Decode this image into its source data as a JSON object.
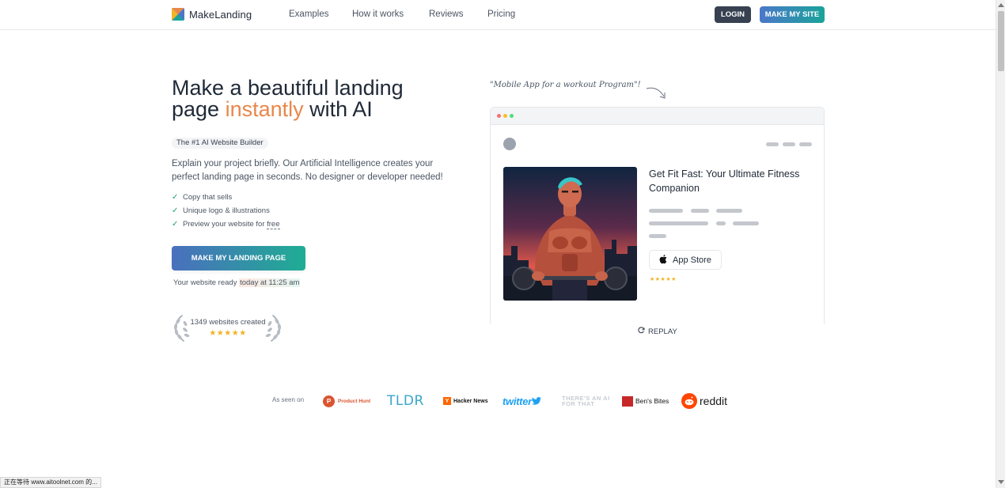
{
  "header": {
    "brand": "MakeLanding",
    "nav": [
      "Examples",
      "How it works",
      "Reviews",
      "Pricing"
    ],
    "login_label": "LOGIN",
    "make_site_label": "MAKE MY SITE"
  },
  "hero": {
    "title_line1": "Make a beautiful landing",
    "title_page": "page",
    "title_accent": "instantly",
    "title_end": "with AI",
    "badge": "The #1 AI Website Builder",
    "description": "Explain your project briefly. Our Artificial Intelligence creates your perfect landing page in seconds. No designer or developer needed!",
    "features": [
      "Copy that sells",
      "Unique logo & illustrations",
      "Preview your website for"
    ],
    "feature_free": "free",
    "cta_label": "MAKE MY LANDING PAGE",
    "ready_prefix": "Your website ready",
    "ready_time": "today at 11:25 am",
    "websites_created": "1349 websites created",
    "rating_stars": "★★★★★"
  },
  "demo": {
    "prompt": "\"Mobile App for a workout Program\"!",
    "headline": "Get Fit Fast: Your Ultimate Fitness Companion",
    "app_store_label": "App Store",
    "stars": "★★★★★",
    "replay_label": "REPLAY"
  },
  "press": {
    "label": "As seen on",
    "logos": [
      "Product Hunt",
      "TLDR",
      "Hacker News",
      "twitter",
      "THERE'S AN AI FOR THAT",
      "Ben's Bites",
      "reddit"
    ]
  },
  "status_bar": "正在等待 www.aitoolnet.com 的...",
  "colors": {
    "accent": "#e8874a",
    "cta_gradient_start": "#4a6fbe",
    "cta_gradient_end": "#1fad93",
    "star": "#f3b225",
    "login_bg": "#374151"
  }
}
